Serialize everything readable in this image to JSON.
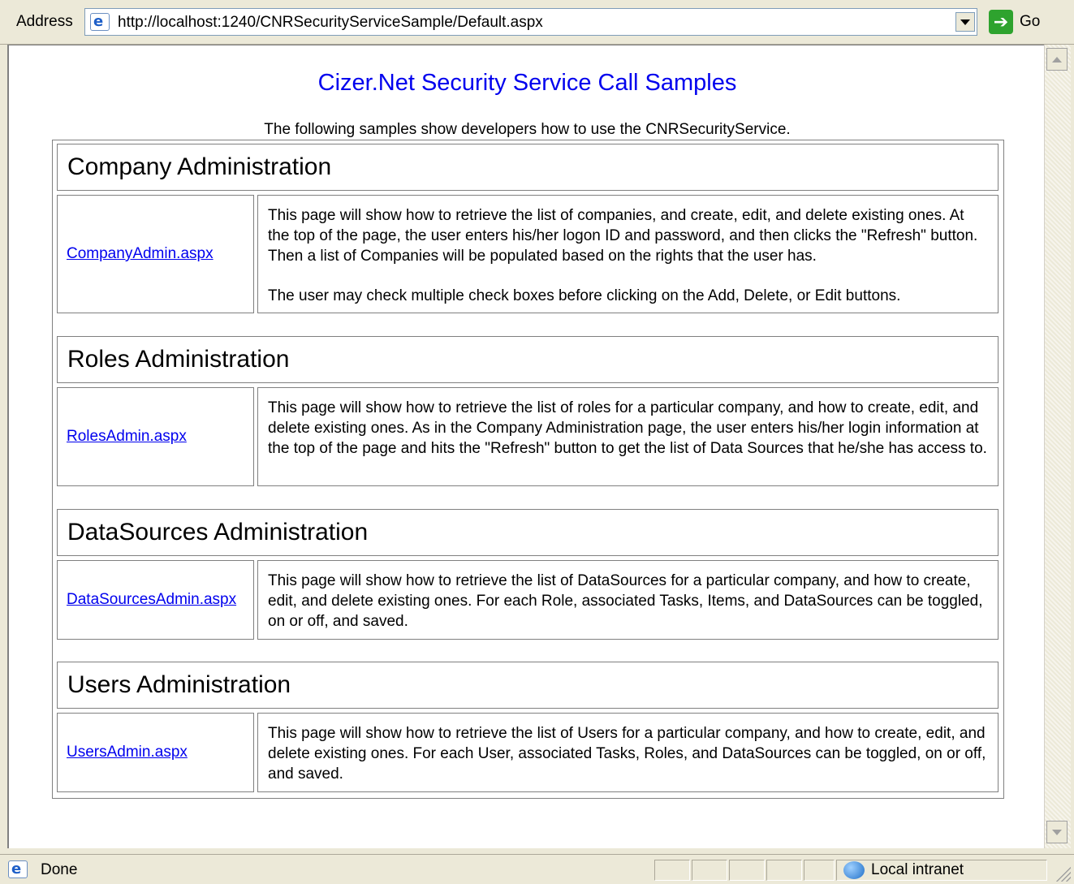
{
  "address_bar": {
    "label": "Address",
    "url": "http://localhost:1240/CNRSecurityServiceSample/Default.aspx",
    "go_label": "Go"
  },
  "page": {
    "title": "Cizer.Net Security Service Call Samples",
    "subtitle": "The following samples show developers how to use the CNRSecurityService.",
    "sections": [
      {
        "heading": "Company Administration",
        "link": "CompanyAdmin.aspx",
        "description": [
          "This page will show how to retrieve the list of companies, and create, edit, and delete existing ones. At the top of the page, the user enters his/her logon ID and password, and then clicks the \"Refresh\" button. Then a list of Companies will be populated based on the rights that the user has.",
          "The user may check multiple check boxes before clicking on the Add, Delete, or Edit buttons."
        ]
      },
      {
        "heading": "Roles Administration",
        "link": "RolesAdmin.aspx",
        "description": [
          "This page will show how to retrieve the list of roles for a particular company, and how to create, edit, and delete existing ones. As in the Company Administration page, the user enters his/her login information at the top of the page and hits the \"Refresh\" button to get the list of Data Sources that he/she has access to."
        ]
      },
      {
        "heading": "DataSources Administration",
        "link": "DataSourcesAdmin.aspx",
        "description": [
          "This page will show how to retrieve the list of DataSources for a particular company, and how to create, edit, and delete existing ones. For each Role, associated Tasks, Items, and DataSources can be toggled, on or off, and saved."
        ]
      },
      {
        "heading": "Users Administration",
        "link": "UsersAdmin.aspx",
        "description": [
          "This page will show how to retrieve the list of Users for a particular company, and how to create, edit, and delete existing ones. For each User, associated Tasks, Roles, and DataSources can be toggled, on or off, and saved."
        ]
      }
    ]
  },
  "status_bar": {
    "status": "Done",
    "zone": "Local intranet"
  }
}
